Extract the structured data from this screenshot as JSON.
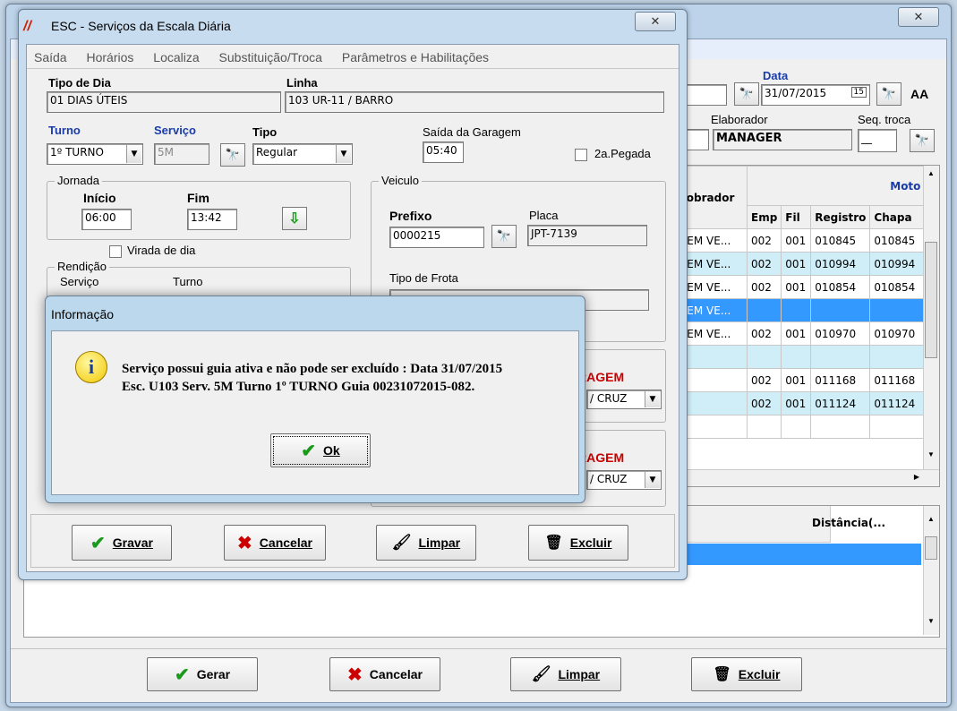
{
  "main_window": {
    "data_label": "Data",
    "date_value": "31/07/2015",
    "elaborador_label": "Elaborador",
    "elaborador_value": "MANAGER",
    "seq_troca_label": "Seq. troca",
    "seq_troca_value": "__",
    "grid": {
      "col_cobrador": "Cobrador",
      "col_motorista_group": "Moto",
      "col_emp": "Emp",
      "col_fil": "Fil",
      "col_registro": "Registro",
      "col_chapa": "Chapa",
      "rows": [
        {
          "cobrador": "GEM VE...",
          "emp": "002",
          "fil": "001",
          "registro": "010845",
          "chapa": "010845"
        },
        {
          "cobrador": "GEM VE...",
          "emp": "002",
          "fil": "001",
          "registro": "010994",
          "chapa": "010994"
        },
        {
          "cobrador": "GEM VE...",
          "emp": "002",
          "fil": "001",
          "registro": "010854",
          "chapa": "010854"
        },
        {
          "cobrador": "GEM VE...",
          "emp": "",
          "fil": "",
          "registro": "",
          "chapa": ""
        },
        {
          "cobrador": "GEM VE...",
          "emp": "002",
          "fil": "001",
          "registro": "010970",
          "chapa": "010970"
        },
        {
          "cobrador": "",
          "emp": "",
          "fil": "",
          "registro": "",
          "chapa": ""
        },
        {
          "cobrador": "",
          "emp": "002",
          "fil": "001",
          "registro": "011168",
          "chapa": "011168"
        },
        {
          "cobrador": "",
          "emp": "002",
          "fil": "001",
          "registro": "011124",
          "chapa": "011124"
        }
      ]
    },
    "lower_grid_col_distancia": "Distância(...",
    "buttons": {
      "gerar": "Gerar",
      "cancelar": "Cancelar",
      "limpar": "Limpar",
      "excluir": "Excluir"
    }
  },
  "esc_dialog": {
    "title": "ESC - Serviços da Escala Diária",
    "menu": [
      "Saída",
      "Horários",
      "Localiza",
      "Substituição/Troca",
      "Parâmetros e Habilitações"
    ],
    "tipo_dia_label": "Tipo de Dia",
    "tipo_dia_value": "01 DIAS ÚTEIS",
    "linha_label": "Linha",
    "linha_value": "103 UR-11 / BARRO",
    "turno_label": "Turno",
    "turno_value": "1º TURNO",
    "servico_label": "Serviço",
    "servico_value": "5M",
    "tipo_label": "Tipo",
    "tipo_value": "Regular",
    "saida_garagem_label": "Saída da Garagem",
    "saida_garagem_value": "05:40",
    "pegada_label": "2a.Pegada",
    "jornada_label": "Jornada",
    "inicio_label": "Início",
    "inicio_value": "06:00",
    "fim_label": "Fim",
    "fim_value": "13:42",
    "virada_label": "Virada de dia",
    "rendicao_label": "Rendição",
    "rendicao_servico_label": "Serviço",
    "rendicao_turno_label": "Turno",
    "veiculo_label": "Veiculo",
    "prefixo_label": "Prefixo",
    "prefixo_value": "0000215",
    "placa_label": "Placa",
    "placa_value": "JPT-7139",
    "tipo_frota_label": "Tipo de Frota",
    "garagem_text_1": "RAGEM",
    "garagem_combo_1": "/ CRUZ",
    "garagem_text_2": "RAGEM",
    "garagem_combo_2": "/ CRUZ",
    "buttons": {
      "gravar": "Gravar",
      "cancelar": "Cancelar",
      "limpar": "Limpar",
      "excluir": "Excluir"
    }
  },
  "info_dialog": {
    "title": "Informação",
    "message_line1": "Serviço possui guia ativa e não pode ser excluído : Data 31/07/2015",
    "message_line2": "Esc. U103 Serv. 5M Turno 1º TURNO Guia 00231072015-082.",
    "ok_label": "Ok"
  },
  "colors": {
    "selected_row": "#3399ff",
    "alt_row": "#cfeef8",
    "accent_red": "#cc0000"
  }
}
